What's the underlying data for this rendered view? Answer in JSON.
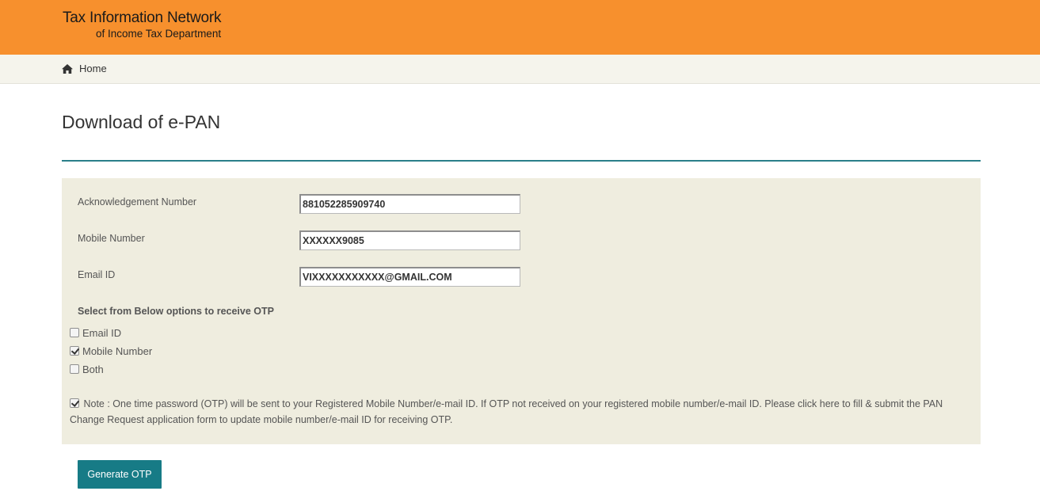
{
  "header": {
    "brand_line1": "Tax Information Network",
    "brand_line2": "of Income Tax Department",
    "background_color": "#f7902d"
  },
  "breadcrumb": {
    "home_icon": "home-icon",
    "home_label": "Home"
  },
  "page": {
    "title": "Download of e-PAN"
  },
  "form": {
    "fields": [
      {
        "label": "Acknowledgement Number",
        "value": "881052285909740"
      },
      {
        "label": "Mobile Number",
        "value": "XXXXXX9085"
      },
      {
        "label": "Email ID",
        "value": "VIXXXXXXXXXXX@GMAIL.COM"
      }
    ],
    "otp_heading": "Select from Below options to receive OTP",
    "otp_options": [
      {
        "label": "Email ID",
        "checked": false
      },
      {
        "label": "Mobile Number",
        "checked": true
      },
      {
        "label": "Both",
        "checked": false
      }
    ],
    "note_checked": true,
    "note": "Note : One time password (OTP) will be sent to your Registered Mobile Number/e-mail ID. If OTP not received on your registered mobile number/e-mail ID. Please click here to fill & submit the PAN Change Request application form to update mobile number/e-mail ID for receiving OTP."
  },
  "actions": {
    "generate_otp_label": "Generate OTP",
    "button_color": "#177b86"
  },
  "colors": {
    "accent_rule": "#2a7f8a",
    "panel_background": "#efeddf",
    "breadcrumb_background": "#f5f4ec"
  }
}
